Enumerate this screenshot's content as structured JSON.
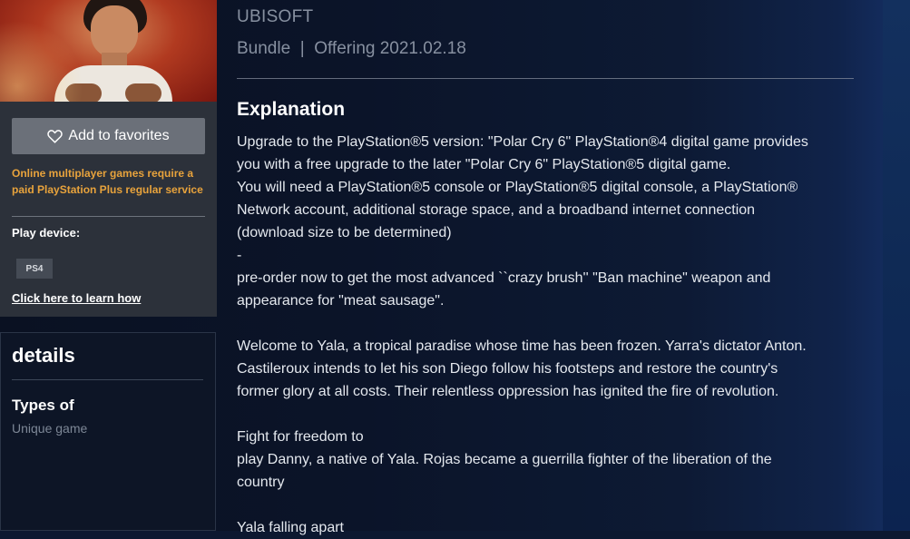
{
  "colors": {
    "accent_notice": "#e8a33c",
    "button_bg": "#6b7079",
    "panel_bg": "#2c313a"
  },
  "sidebar": {
    "favorite_label": "Add to favorites",
    "favorite_icon": "heart-outline-icon",
    "notice": "Online multiplayer games require a paid PlayStation Plus regular service",
    "play_device_label": "Play device:",
    "platform_badge": "PS4",
    "learn_link": "Click here to learn how"
  },
  "details": {
    "title": "details",
    "types_label": "Types of",
    "types_value": "Unique game"
  },
  "header": {
    "publisher": "UBISOFT",
    "meta": "Bundle  |  Offering 2021.02.18"
  },
  "explanation": {
    "title": "Explanation",
    "lines": [
      "Upgrade to the PlayStation®5 version: \"Polar Cry 6\" PlayStation®4 digital game provides",
      "you with a free upgrade to the later \"Polar Cry 6\" PlayStation®5 digital game.",
      "You will need a PlayStation®5 console or PlayStation®5 digital console, a PlayStation®",
      "Network account, additional storage space, and a broadband internet connection",
      "(download size to be determined)",
      "-",
      "pre-order now to get the most advanced ``crazy brush'' \"Ban machine\" weapon and",
      "appearance for \"meat sausage\".",
      "",
      "Welcome to Yala, a tropical paradise whose time has been frozen. Yarra's dictator Anton.",
      "Castileroux intends to let his son Diego follow his footsteps and restore the country's",
      "former glory at all costs. Their relentless oppression has ignited the fire of revolution.",
      "",
      "Fight for freedom to",
      "play Danny, a native of Yala. Rojas became a guerrilla fighter of the liberation of the",
      "country",
      "",
      "Yala falling apart"
    ]
  }
}
